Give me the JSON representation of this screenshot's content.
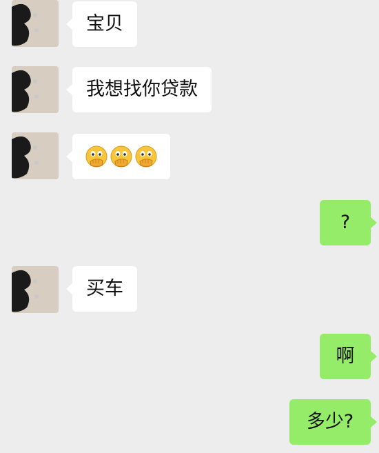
{
  "colors": {
    "background": "#ededed",
    "incoming_bubble": "#ffffff",
    "outgoing_bubble": "#95ec69",
    "text": "#111111"
  },
  "messages": [
    {
      "side": "incoming",
      "text": "宝贝"
    },
    {
      "side": "incoming",
      "text": "我想找你贷款"
    },
    {
      "side": "incoming",
      "emoji": "face-hand-over-mouth-emoji",
      "emoji_count": 3
    },
    {
      "side": "outgoing",
      "text": "?"
    },
    {
      "side": "incoming",
      "text": "买车"
    },
    {
      "side": "outgoing",
      "text": "啊"
    },
    {
      "side": "outgoing",
      "text": "多少?"
    }
  ]
}
